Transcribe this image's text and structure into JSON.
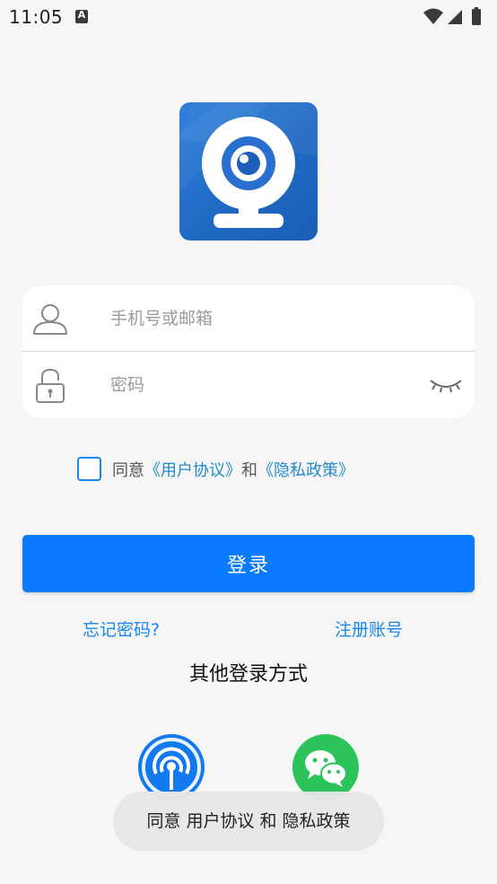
{
  "status_bar": {
    "time": "11:05",
    "notification_icon": "A",
    "icons": [
      "wifi-icon",
      "signal-icon",
      "battery-icon"
    ]
  },
  "logo": {
    "icon": "webcam-icon",
    "brand_color": "#1f69c3"
  },
  "login_form": {
    "phone_placeholder": "手机号或邮箱",
    "phone_value": "",
    "password_placeholder": "密码",
    "password_value": "",
    "user_icon": "user-icon",
    "lock_icon": "lock-icon",
    "eye_icon": "eye-closed-icon"
  },
  "agreement": {
    "checked": false,
    "prefix": "同意",
    "user_agreement": "《用户协议》",
    "and": "和",
    "privacy_policy": "《隐私政策》",
    "link_color": "#1f8ac9"
  },
  "login_button": {
    "label": "登录",
    "color": "#0a7aff"
  },
  "links": {
    "forgot_password": "忘记密码?",
    "register": "注册账号"
  },
  "other_login": {
    "title": "其他登录方式",
    "methods": [
      {
        "icon": "wifi-signal-icon",
        "color": "#1379ee"
      },
      {
        "icon": "wechat-icon",
        "color": "#2cc35a"
      }
    ]
  },
  "toast": {
    "message": "同意 用户协议 和 隐私政策"
  }
}
